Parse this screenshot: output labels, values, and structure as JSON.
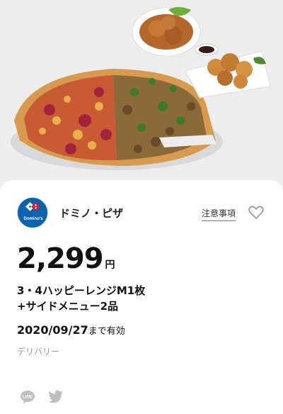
{
  "coupon": {
    "brand": "ドミノ・ピザ",
    "logo_text": "Domino's",
    "notice_label": "注意事項",
    "price": "2,299",
    "currency": "円",
    "title_lines": [
      "3・4ハッピーレンジM1枚",
      "+サイドメニュー2品"
    ],
    "valid_date": "2020/09/27",
    "valid_suffix": "まで有効",
    "category": "デリバリー"
  },
  "icons": {
    "favorite": "heart-outline-icon",
    "share_line": "line-icon",
    "share_twitter": "twitter-icon",
    "logo": "dominos-logo"
  },
  "colors": {
    "brand_blue": "#0b63b0",
    "brand_red": "#e31837",
    "card_bg": "#ffffff",
    "page_bg": "#ececec"
  }
}
